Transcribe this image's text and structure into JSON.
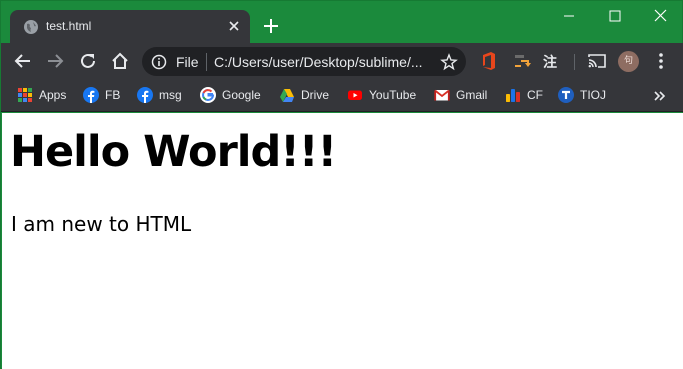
{
  "tab": {
    "title": "test.html"
  },
  "omnibox": {
    "scheme": "File",
    "url": "C:/Users/user/Desktop/sublime/..."
  },
  "extensions": {
    "zhu": "注"
  },
  "avatar": {
    "label": "句"
  },
  "bookmarks": [
    {
      "label": "Apps",
      "icon": "apps-grid-icon"
    },
    {
      "label": "FB",
      "icon": "facebook-icon"
    },
    {
      "label": "msg",
      "icon": "facebook-icon"
    },
    {
      "label": "Google",
      "icon": "google-icon"
    },
    {
      "label": "Drive",
      "icon": "drive-icon"
    },
    {
      "label": "YouTube",
      "icon": "youtube-icon"
    },
    {
      "label": "Gmail",
      "icon": "gmail-icon"
    },
    {
      "label": "CF",
      "icon": "codeforces-icon"
    },
    {
      "label": "TIOJ",
      "icon": "tioj-icon"
    }
  ],
  "page": {
    "heading": "Hello World!!!",
    "paragraph": "I am new to HTML"
  },
  "colors": {
    "frame": "#1b8a3c",
    "toolbar": "#35363a",
    "omnibox": "#202124",
    "content": "#ffffff"
  }
}
